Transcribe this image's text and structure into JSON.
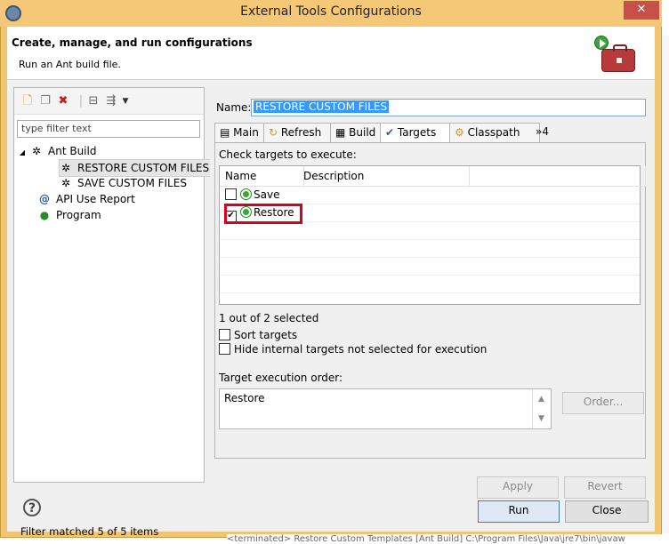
{
  "window": {
    "title": "External Tools Configurations",
    "close_glyph": "✕"
  },
  "header": {
    "title": "Create, manage, and run configurations",
    "subtitle": "Run an Ant build file."
  },
  "left_panel": {
    "filter_placeholder": "type filter text",
    "tree": {
      "ant_build": "Ant Build",
      "restore": "RESTORE CUSTOM FILES",
      "save": "SAVE CUSTOM FILES",
      "api_report": "API Use Report",
      "program": "Program"
    },
    "status": "Filter matched 5 of 5 items"
  },
  "right_panel": {
    "name_label": "Name:",
    "name_value": "RESTORE CUSTOM FILES",
    "tabs": {
      "main": "Main",
      "refresh": "Refresh",
      "build": "Build",
      "targets": "Targets",
      "classpath": "Classpath",
      "overflow": "»4"
    },
    "targets": {
      "check_label": "Check targets to execute:",
      "col_name": "Name",
      "col_description": "Description",
      "rows": [
        {
          "name": "Save",
          "checked": false
        },
        {
          "name": "Restore",
          "checked": true
        }
      ],
      "selected_count": "1 out of 2 selected",
      "sort_label": "Sort targets",
      "hide_label": "Hide internal targets not selected for execution",
      "order_label": "Target execution order:",
      "order_value": "Restore",
      "order_button": "Order..."
    },
    "apply_button": "Apply",
    "revert_button": "Revert"
  },
  "footer": {
    "run_button": "Run",
    "close_button": "Close",
    "help_glyph": "?",
    "background_text": "<terminated> Restore Custom Templates [Ant Build] C:\\Program Files\\Java\\jre7\\bin\\javaw"
  },
  "colors": {
    "title_bar": "#f5c878",
    "close_button": "#c7504a",
    "selection": "#3399ff",
    "highlight": "#d8001f"
  }
}
